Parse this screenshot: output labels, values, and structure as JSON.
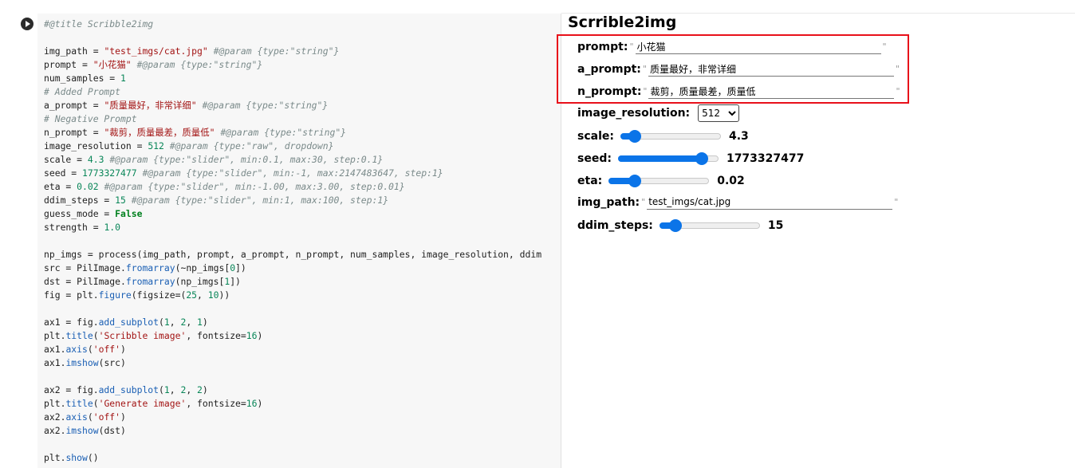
{
  "code": {
    "lines": [
      [
        {
          "c": "cm",
          "t": "#@title Scribble2img"
        }
      ],
      [],
      [
        {
          "c": "",
          "t": "img_path = "
        },
        {
          "c": "st",
          "t": "\"test_imgs/cat.jpg\""
        },
        {
          "c": "",
          "t": " "
        },
        {
          "c": "cm",
          "t": "#@param {type:\"string\"}"
        }
      ],
      [
        {
          "c": "",
          "t": "prompt = "
        },
        {
          "c": "st",
          "t": "\"小花猫\""
        },
        {
          "c": "",
          "t": " "
        },
        {
          "c": "cm",
          "t": "#@param {type:\"string\"}"
        }
      ],
      [
        {
          "c": "",
          "t": "num_samples = "
        },
        {
          "c": "nu",
          "t": "1"
        }
      ],
      [
        {
          "c": "cm",
          "t": "# Added Prompt"
        }
      ],
      [
        {
          "c": "",
          "t": "a_prompt = "
        },
        {
          "c": "st",
          "t": "\"质量最好，非常详细\""
        },
        {
          "c": "",
          "t": " "
        },
        {
          "c": "cm",
          "t": "#@param {type:\"string\"}"
        }
      ],
      [
        {
          "c": "cm",
          "t": "# Negative Prompt"
        }
      ],
      [
        {
          "c": "",
          "t": "n_prompt = "
        },
        {
          "c": "st",
          "t": "\"裁剪，质量最差，质量低\""
        },
        {
          "c": "",
          "t": " "
        },
        {
          "c": "cm",
          "t": "#@param {type:\"string\"}"
        }
      ],
      [
        {
          "c": "",
          "t": "image_resolution = "
        },
        {
          "c": "nu",
          "t": "512"
        },
        {
          "c": "",
          "t": " "
        },
        {
          "c": "cm",
          "t": "#@param {type:\"raw\", dropdown}"
        }
      ],
      [
        {
          "c": "",
          "t": "scale = "
        },
        {
          "c": "nu",
          "t": "4.3"
        },
        {
          "c": "",
          "t": " "
        },
        {
          "c": "cm",
          "t": "#@param {type:\"slider\", min:0.1, max:30, step:0.1}"
        }
      ],
      [
        {
          "c": "",
          "t": "seed = "
        },
        {
          "c": "nu",
          "t": "1773327477"
        },
        {
          "c": "",
          "t": " "
        },
        {
          "c": "cm",
          "t": "#@param {type:\"slider\", min:-1, max:2147483647, step:1}"
        }
      ],
      [
        {
          "c": "",
          "t": "eta = "
        },
        {
          "c": "nu",
          "t": "0.02"
        },
        {
          "c": "",
          "t": " "
        },
        {
          "c": "cm",
          "t": "#@param {type:\"slider\", min:-1.00, max:3.00, step:0.01}"
        }
      ],
      [
        {
          "c": "",
          "t": "ddim_steps = "
        },
        {
          "c": "nu",
          "t": "15"
        },
        {
          "c": "",
          "t": " "
        },
        {
          "c": "cm",
          "t": "#@param {type:\"slider\", min:1, max:100, step:1}"
        }
      ],
      [
        {
          "c": "",
          "t": "guess_mode = "
        },
        {
          "c": "kw",
          "t": "False"
        }
      ],
      [
        {
          "c": "",
          "t": "strength = "
        },
        {
          "c": "nu",
          "t": "1.0"
        }
      ],
      [],
      [
        {
          "c": "",
          "t": "np_imgs = process(img_path, prompt, a_prompt, n_prompt, num_samples, image_resolution, ddim"
        }
      ],
      [
        {
          "c": "",
          "t": "src = PilImage."
        },
        {
          "c": "fn",
          "t": "fromarray"
        },
        {
          "c": "",
          "t": "(~np_imgs["
        },
        {
          "c": "nu",
          "t": "0"
        },
        {
          "c": "",
          "t": "])"
        }
      ],
      [
        {
          "c": "",
          "t": "dst = PilImage."
        },
        {
          "c": "fn",
          "t": "fromarray"
        },
        {
          "c": "",
          "t": "(np_imgs["
        },
        {
          "c": "nu",
          "t": "1"
        },
        {
          "c": "",
          "t": "])"
        }
      ],
      [
        {
          "c": "",
          "t": "fig = plt."
        },
        {
          "c": "fn",
          "t": "figure"
        },
        {
          "c": "",
          "t": "(figsize=("
        },
        {
          "c": "nu",
          "t": "25"
        },
        {
          "c": "",
          "t": ", "
        },
        {
          "c": "nu",
          "t": "10"
        },
        {
          "c": "",
          "t": "))"
        }
      ],
      [],
      [
        {
          "c": "",
          "t": "ax1 = fig."
        },
        {
          "c": "fn",
          "t": "add_subplot"
        },
        {
          "c": "",
          "t": "("
        },
        {
          "c": "nu",
          "t": "1"
        },
        {
          "c": "",
          "t": ", "
        },
        {
          "c": "nu",
          "t": "2"
        },
        {
          "c": "",
          "t": ", "
        },
        {
          "c": "nu",
          "t": "1"
        },
        {
          "c": "",
          "t": ")"
        }
      ],
      [
        {
          "c": "",
          "t": "plt."
        },
        {
          "c": "fn",
          "t": "title"
        },
        {
          "c": "",
          "t": "("
        },
        {
          "c": "st",
          "t": "'Scribble image'"
        },
        {
          "c": "",
          "t": ", fontsize="
        },
        {
          "c": "nu",
          "t": "16"
        },
        {
          "c": "",
          "t": ")"
        }
      ],
      [
        {
          "c": "",
          "t": "ax1."
        },
        {
          "c": "fn",
          "t": "axis"
        },
        {
          "c": "",
          "t": "("
        },
        {
          "c": "st",
          "t": "'off'"
        },
        {
          "c": "",
          "t": ")"
        }
      ],
      [
        {
          "c": "",
          "t": "ax1."
        },
        {
          "c": "fn",
          "t": "imshow"
        },
        {
          "c": "",
          "t": "(src)"
        }
      ],
      [],
      [
        {
          "c": "",
          "t": "ax2 = fig."
        },
        {
          "c": "fn",
          "t": "add_subplot"
        },
        {
          "c": "",
          "t": "("
        },
        {
          "c": "nu",
          "t": "1"
        },
        {
          "c": "",
          "t": ", "
        },
        {
          "c": "nu",
          "t": "2"
        },
        {
          "c": "",
          "t": ", "
        },
        {
          "c": "nu",
          "t": "2"
        },
        {
          "c": "",
          "t": ")"
        }
      ],
      [
        {
          "c": "",
          "t": "plt."
        },
        {
          "c": "fn",
          "t": "title"
        },
        {
          "c": "",
          "t": "("
        },
        {
          "c": "st",
          "t": "'Generate image'"
        },
        {
          "c": "",
          "t": ", fontsize="
        },
        {
          "c": "nu",
          "t": "16"
        },
        {
          "c": "",
          "t": ")"
        }
      ],
      [
        {
          "c": "",
          "t": "ax2."
        },
        {
          "c": "fn",
          "t": "axis"
        },
        {
          "c": "",
          "t": "("
        },
        {
          "c": "st",
          "t": "'off'"
        },
        {
          "c": "",
          "t": ")"
        }
      ],
      [
        {
          "c": "",
          "t": "ax2."
        },
        {
          "c": "fn",
          "t": "imshow"
        },
        {
          "c": "",
          "t": "(dst)"
        }
      ],
      [],
      [
        {
          "c": "",
          "t": "plt."
        },
        {
          "c": "fn",
          "t": "show"
        },
        {
          "c": "",
          "t": "()"
        }
      ]
    ]
  },
  "form": {
    "title": "Scrrible2img",
    "quote": "\"",
    "prompt": {
      "label": "prompt:",
      "value": "小花猫"
    },
    "a_prompt": {
      "label": "a_prompt:",
      "value": "质量最好，非常详细"
    },
    "n_prompt": {
      "label": "n_prompt:",
      "value": "裁剪，质量最差，质量低"
    },
    "image_resolution": {
      "label": "image_resolution:",
      "value": "512",
      "options": [
        "512"
      ]
    },
    "scale": {
      "label": "scale:",
      "value": "4.3",
      "level": 0.14
    },
    "seed": {
      "label": "seed:",
      "value": "1773327477",
      "level": 0.83
    },
    "eta": {
      "label": "eta:",
      "value": "0.02",
      "level": 0.26
    },
    "img_path": {
      "label": "img_path:",
      "value": "test_imgs/cat.jpg"
    },
    "ddim_steps": {
      "label": "ddim_steps:",
      "value": "15",
      "level": 0.16
    }
  },
  "colors": {
    "highlight": "#e8101a",
    "slider_accent": "#0b74e8"
  }
}
